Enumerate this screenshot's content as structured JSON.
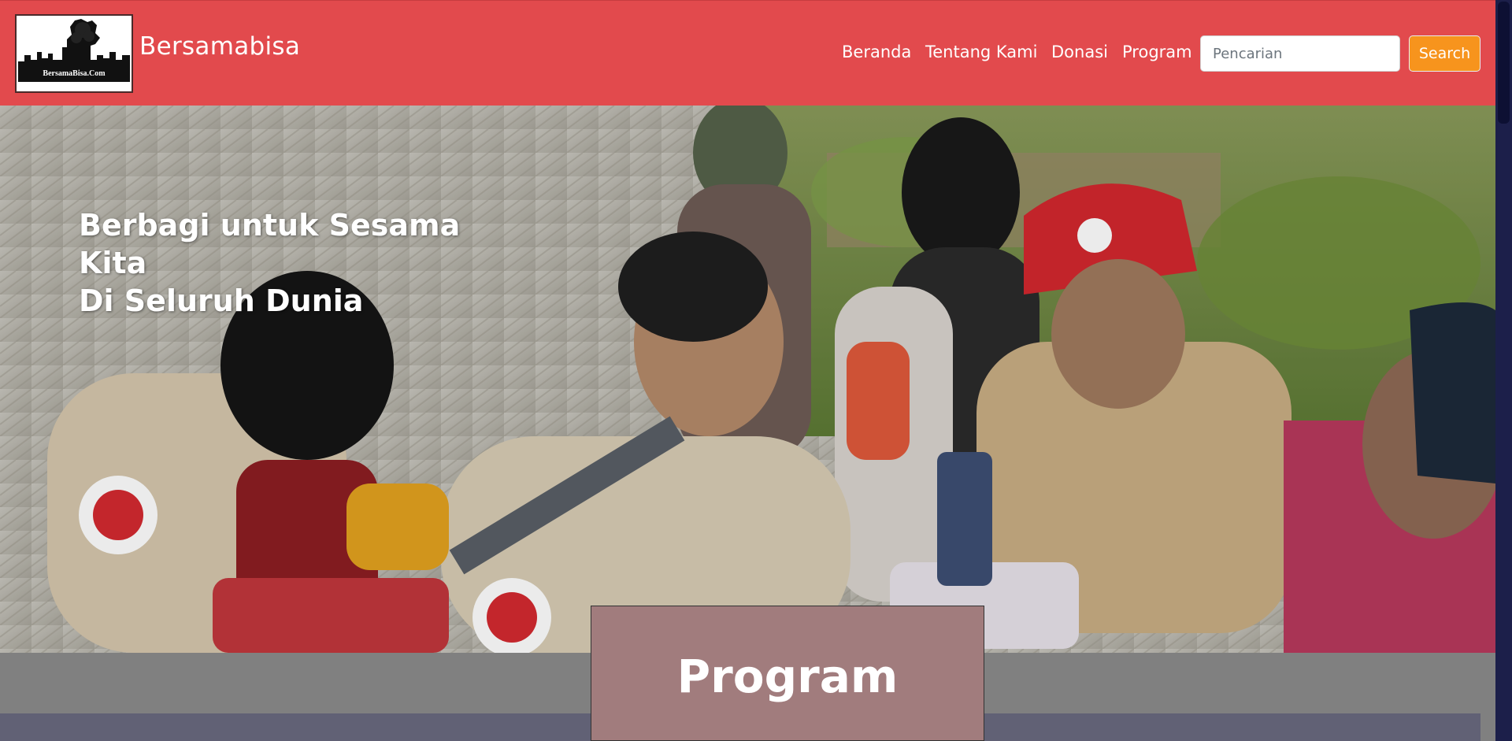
{
  "brand": {
    "name": "Bersamabisa",
    "logo_text": "BersamaBisa.Com"
  },
  "nav": {
    "items": [
      {
        "label": "Beranda"
      },
      {
        "label": "Tentang Kami"
      },
      {
        "label": "Donasi"
      },
      {
        "label": "Program"
      }
    ]
  },
  "search": {
    "placeholder": "Pencarian",
    "button_label": "Search"
  },
  "hero": {
    "title_line1": "Berbagi untuk Sesama Kita",
    "title_line2": "Di Seluruh Dunia"
  },
  "section": {
    "program_title": "Program"
  },
  "colors": {
    "navbar": "#e24a4d",
    "search_button": "#f7941d",
    "program_box": "#a17c7d",
    "band": "#616175",
    "page_background": "#808080"
  }
}
